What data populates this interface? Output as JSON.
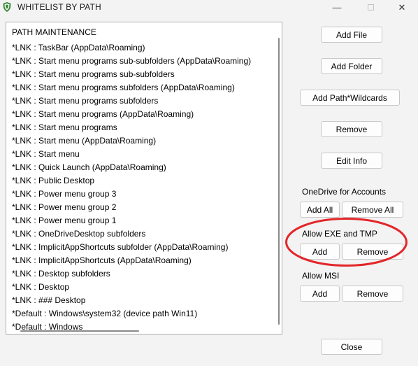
{
  "window": {
    "title": "WHITELIST BY PATH",
    "icon": "shield-app-icon",
    "minimize_glyph": "—",
    "close_glyph": "✕"
  },
  "list": {
    "header": "PATH MAINTENANCE",
    "items": [
      "*LNK : TaskBar (AppData\\Roaming)",
      "*LNK : Start menu programs sub-subfolders (AppData\\Roaming)",
      "*LNK : Start menu programs sub-subfolders",
      "*LNK : Start menu programs subfolders (AppData\\Roaming)",
      "*LNK : Start menu programs subfolders",
      "*LNK : Start menu programs (AppData\\Roaming)",
      "*LNK : Start menu programs",
      "*LNK : Start menu (AppData\\Roaming)",
      "*LNK : Start menu",
      "*LNK : Quick Launch (AppData\\Roaming)",
      "*LNK : Public Desktop",
      "*LNK : Power menu group 3",
      "*LNK : Power menu group 2",
      "*LNK : Power menu group 1",
      "*LNK : OneDriveDesktop subfolders",
      "*LNK : ImplicitAppShortcuts subfolder (AppData\\Roaming)",
      "*LNK : ImplicitAppShortcuts (AppData\\Roaming)",
      "*LNK : Desktop subfolders",
      "*LNK : Desktop",
      "*LNK : ### Desktop",
      "*Default : Windows\\system32  (device path Win11)",
      "*Default : Windows"
    ]
  },
  "buttons": {
    "add_file": "Add File",
    "add_folder": "Add Folder",
    "add_path_wildcards": "Add Path*Wildcards",
    "remove": "Remove",
    "edit_info": "Edit Info",
    "close": "Close"
  },
  "onedrive": {
    "label": "OneDrive for Accounts",
    "add_all": "Add All",
    "remove_all": "Remove All"
  },
  "exe_tmp": {
    "label": "Allow EXE and TMP",
    "add": "Add",
    "remove": "Remove"
  },
  "msi": {
    "label": "Allow MSI",
    "add": "Add",
    "remove": "Remove"
  },
  "colors": {
    "annotation": "#e3262a",
    "icon_green": "#3b8a3a"
  }
}
